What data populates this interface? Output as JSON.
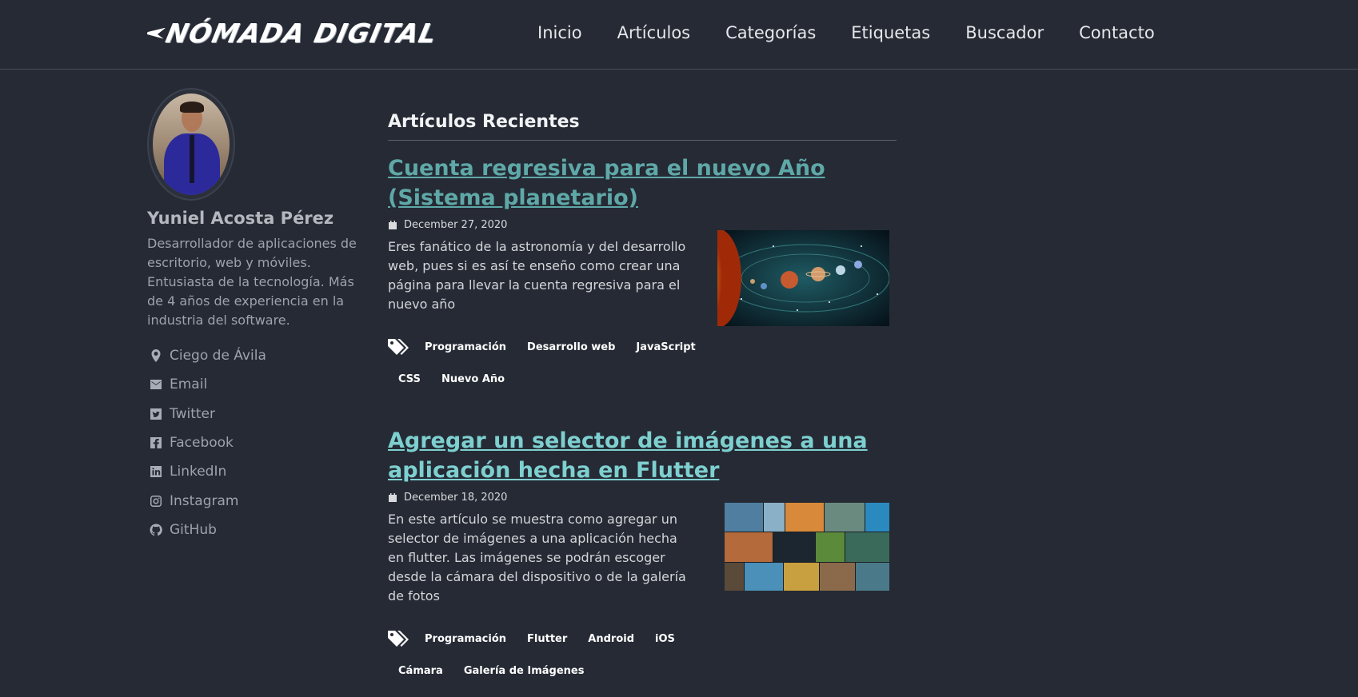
{
  "header": {
    "logo_text": "NÓMADA DIGITAL",
    "nav": [
      "Inicio",
      "Artículos",
      "Categorías",
      "Etiquetas",
      "Buscador",
      "Contacto"
    ]
  },
  "sidebar": {
    "name": "Yuniel Acosta Pérez",
    "bio": "Desarrollador de aplicaciones de escritorio, web y móviles. Entusiasta de la tecnología. Más de 4 años de experiencia en la industria del software.",
    "links": [
      {
        "label": "Ciego de Ávila",
        "icon": "map-pin-icon"
      },
      {
        "label": "Email",
        "icon": "envelope-icon"
      },
      {
        "label": "Twitter",
        "icon": "twitter-icon"
      },
      {
        "label": "Facebook",
        "icon": "facebook-icon"
      },
      {
        "label": "LinkedIn",
        "icon": "linkedin-icon"
      },
      {
        "label": "Instagram",
        "icon": "instagram-icon"
      },
      {
        "label": "GitHub",
        "icon": "github-icon"
      }
    ]
  },
  "main": {
    "section_title": "Artículos Recientes",
    "posts": [
      {
        "title": "Cuenta regresiva para el nuevo Año (Sistema planetario)",
        "date": "December 27, 2020",
        "excerpt": "Eres fanático de la astronomía y del desarrollo web, pues si es así te enseño como crear una página para llevar la cuenta regresiva para el nuevo año",
        "tags": [
          "Programación",
          "Desarrollo web",
          "JavaScript",
          "CSS",
          "Nuevo Año"
        ],
        "title_color": "#5fa8a8"
      },
      {
        "title": "Agregar un selector de imágenes a una aplicación hecha en Flutter",
        "date": "December 18, 2020",
        "excerpt": "En este artículo se muestra como agregar un selector de imágenes a una aplicación hecha en flutter. Las imágenes se podrán escoger desde la cámara del dispositivo o de la galería de fotos",
        "tags": [
          "Programación",
          "Flutter",
          "Android",
          "iOS",
          "Cámara",
          "Galería de Imágenes"
        ],
        "title_color": "#7ed0d0"
      }
    ]
  },
  "colors": {
    "background": "#252a34",
    "link_visited": "#5fa8a8",
    "link": "#7ed0d0"
  }
}
